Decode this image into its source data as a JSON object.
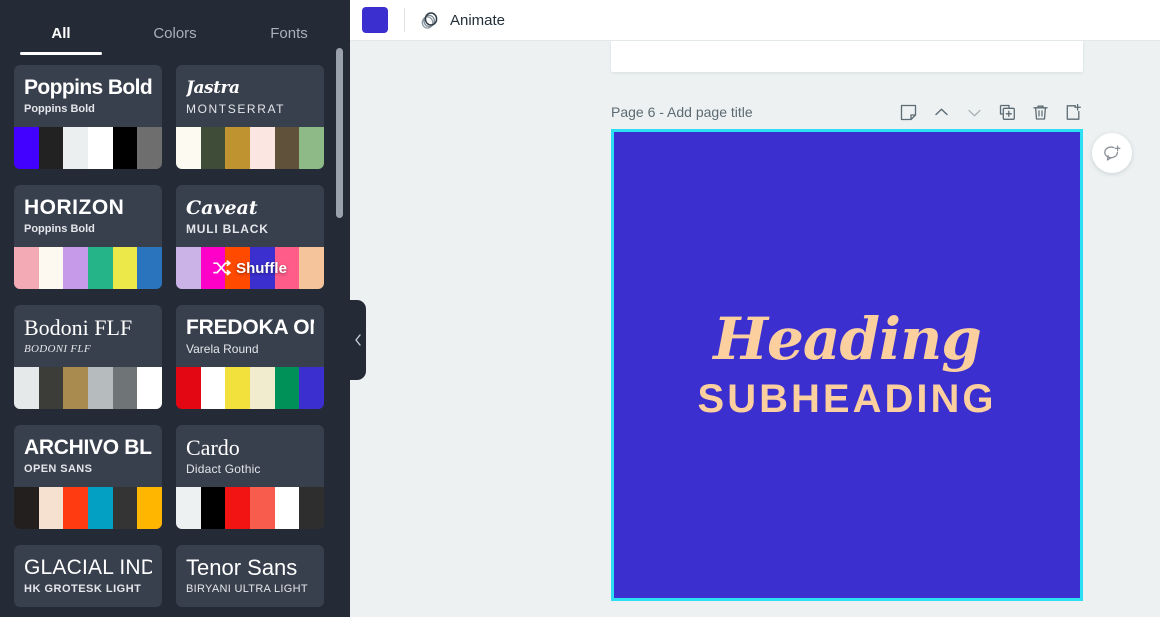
{
  "panel": {
    "tabs": [
      {
        "label": "All",
        "active": true
      },
      {
        "label": "Colors",
        "active": false
      },
      {
        "label": "Fonts",
        "active": false
      }
    ],
    "shuffle_label": "Shuffle",
    "cards": [
      {
        "title": "Poppins Bold",
        "subtitle": "Poppins Bold",
        "title_style": "st-poppins",
        "sub_style": "st-poppins-sub",
        "title_size": "21px",
        "swatches": [
          "#4200ff",
          "#222222",
          "#eceff0",
          "#ffffff",
          "#000000",
          "#6e6e6e"
        ],
        "shuffle": false
      },
      {
        "title": "Jastra",
        "subtitle": "MONTSERRAT",
        "title_style": "st-script",
        "sub_style": "st-montser",
        "title_size": "17px",
        "swatches": [
          "#fdfaf1",
          "#3e4c38",
          "#bf932f",
          "#fbe6e2",
          "#60513a",
          "#8dba86"
        ],
        "shuffle": false
      },
      {
        "title": "HORIZON",
        "subtitle": "Poppins Bold",
        "title_style": "st-horizon",
        "sub_style": "st-poppins-sub",
        "title_size": "21px",
        "swatches": [
          "#f3aab4",
          "#fdf9f0",
          "#c69ae8",
          "#25b487",
          "#ece84a",
          "#2a74bd"
        ],
        "shuffle": false
      },
      {
        "title": "Caveat",
        "subtitle": "MULI BLACK",
        "title_style": "st-caveat",
        "sub_style": "st-muli",
        "title_size": "19px",
        "swatches": [
          "#cbb3e8",
          "#ff00c8",
          "#ff4a00",
          "#3b2fd0",
          "#ff5c8a",
          "#f5c49b"
        ],
        "shuffle": true
      },
      {
        "title": "Bodoni FLF",
        "subtitle": "BODONI FLF",
        "title_style": "st-bodoni",
        "sub_style": "st-bodoni-sub",
        "title_size": "22px",
        "swatches": [
          "#e6e9ea",
          "#3c3c39",
          "#a98a4f",
          "#b6bcbd",
          "#6f7577",
          "#ffffff"
        ],
        "shuffle": false
      },
      {
        "title": "FREDOKA ONE",
        "subtitle": "Varela Round",
        "title_style": "st-fredoka",
        "sub_style": "st-varela",
        "title_size": "21px",
        "swatches": [
          "#e30613",
          "#ffffff",
          "#f2e03c",
          "#f2ecce",
          "#009159",
          "#3b2fd0"
        ],
        "shuffle": false
      },
      {
        "title": "ARCHIVO BLACK",
        "subtitle": "OPEN SANS",
        "title_style": "st-archivo",
        "sub_style": "st-opensans",
        "title_size": "21px",
        "swatches": [
          "#231f1e",
          "#f6e1d1",
          "#ff3b12",
          "#04a0c4",
          "#343434",
          "#ffb600"
        ],
        "shuffle": false
      },
      {
        "title": "Cardo",
        "subtitle": "Didact Gothic",
        "title_style": "st-cardo",
        "sub_style": "st-didact",
        "title_size": "22px",
        "swatches": [
          "#eef1f2",
          "#000000",
          "#f21313",
          "#f85c4d",
          "#ffffff",
          "#2e2e2e"
        ],
        "shuffle": false
      },
      {
        "title": "GLACIAL INDIFFERENCE",
        "subtitle": "HK GROTESK LIGHT",
        "title_style": "st-glacial",
        "sub_style": "st-hkgrotesk",
        "title_size": "21px",
        "swatches": [],
        "shuffle": false
      },
      {
        "title": "Tenor Sans",
        "subtitle": "BIRYANI ULTRA LIGHT",
        "title_style": "st-tenor",
        "sub_style": "st-biryani",
        "title_size": "22px",
        "swatches": [],
        "shuffle": false
      }
    ]
  },
  "toolbar": {
    "color_chip": "#3b2fd0",
    "animate_label": "Animate"
  },
  "page": {
    "label": "Page 6 - Add page title",
    "canvas_color": "#3b2fd0",
    "selection_color": "#2ddff2",
    "heading": "Heading",
    "subheading": "SUBHEADING",
    "text_color": "#fbcf9e"
  }
}
